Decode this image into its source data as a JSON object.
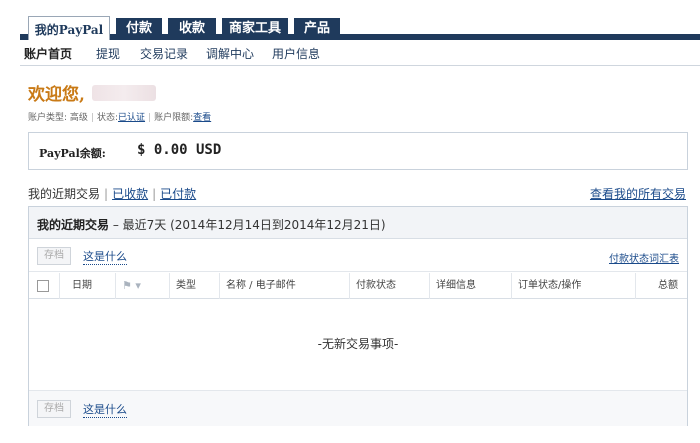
{
  "topnav": {
    "tabs": [
      {
        "label": "我的PayPal",
        "active": true
      },
      {
        "label": "付款",
        "active": false
      },
      {
        "label": "收款",
        "active": false
      },
      {
        "label": "商家工具",
        "active": false
      },
      {
        "label": "产品",
        "active": false
      }
    ]
  },
  "subnav": {
    "items": [
      "账户首页",
      "提现",
      "交易记录",
      "调解中心",
      "用户信息"
    ]
  },
  "welcome": {
    "greeting": "欢迎您,",
    "account_type_label": "账户类型:",
    "account_type_value": "高级",
    "status_label": "状态:",
    "status_value": "已认证",
    "limit_label": "账户限额:",
    "limit_link": "查看"
  },
  "balance": {
    "label": "PayPal余额:",
    "amount": "$ 0.00 USD"
  },
  "filter": {
    "current": "我的近期交易",
    "received": "已收款",
    "paid": "已付款",
    "view_all": "查看我的所有交易"
  },
  "panel": {
    "title": "我的近期交易",
    "subtitle": " – 最近7天 (2014年12月14日到2014年12月21日)",
    "archive_button": "存档",
    "what_is_this": "这是什么",
    "glossary_link": "付款状态词汇表",
    "columns": [
      "日期",
      "类型",
      "名称 / 电子邮件",
      "付款状态",
      "详细信息",
      "订单状态/操作",
      "总额"
    ],
    "empty_message": "-无新交易事项-"
  },
  "colors": {
    "nav_dark": "#1f3a5c",
    "welcome_orange": "#c97a16",
    "link_blue": "#1a4a8a"
  }
}
